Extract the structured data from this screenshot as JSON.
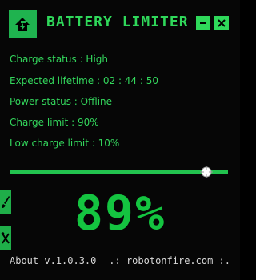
{
  "window": {
    "title": "BATTERY LIMITER",
    "logo_icon": "battery-logo-icon",
    "minimize_icon": "minimize-icon",
    "close_icon": "close-icon"
  },
  "info": {
    "charge_status": "Charge status : High",
    "expected_lifetime": "Expected lifetime : 02 : 44 : 50",
    "power_status": "Power status : Offline",
    "charge_limit": "Charge limit : 90%",
    "low_charge_limit": "Low charge limit : 10%"
  },
  "slider": {
    "value_percent": 90
  },
  "battery": {
    "percent_display": "89%"
  },
  "side_buttons": [
    {
      "icon": "brush-icon"
    },
    {
      "icon": "tools-icon"
    }
  ],
  "footer": {
    "about": "About v.1.0.3.0",
    "link": ".: robotonfire.com :."
  },
  "colors": {
    "accent": "#2fd85a",
    "background": "#060606",
    "footer_text": "#d7d7d7"
  }
}
